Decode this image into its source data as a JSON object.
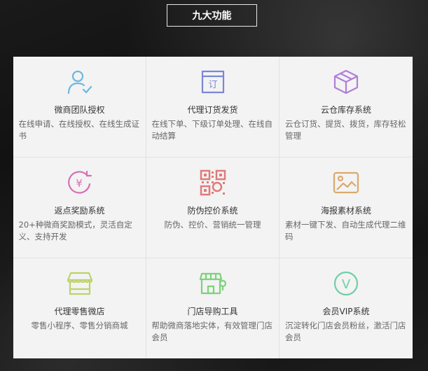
{
  "header": {
    "title": "九大功能"
  },
  "features": [
    {
      "icon": "user-check-icon",
      "color": "#6bb8e0",
      "name": "微商团队授权",
      "desc": "在线申请、在线授权、在线生成证书"
    },
    {
      "icon": "order-box-icon",
      "color": "#7c86d6",
      "name": "代理订货发货",
      "desc": "在线下单、下级订单处理、在线自动结算",
      "glyph": "订"
    },
    {
      "icon": "cube-icon",
      "color": "#b07fd8",
      "name": "云仓库存系统",
      "desc": "云仓订货、提货、拨货，库存轻松管理"
    },
    {
      "icon": "yen-rebate-icon",
      "color": "#d86fb3",
      "name": "返点奖励系统",
      "desc": "20+种微商奖励模式，灵活自定义、支持开发",
      "glyph": "¥"
    },
    {
      "icon": "qr-code-icon",
      "color": "#e07a7a",
      "name": "防伪控价系统",
      "desc": "防伪、控价、营销统一管理"
    },
    {
      "icon": "image-icon",
      "color": "#d9aa6a",
      "name": "海报素材系统",
      "desc": "素材一键下发、自动生成代理二维码"
    },
    {
      "icon": "store-icon",
      "color": "#bcd36a",
      "name": "代理零售微店",
      "desc": "零售小程序、零售分销商城"
    },
    {
      "icon": "shop-guide-icon",
      "color": "#7cd27a",
      "name": "门店导购工具",
      "desc": "帮助微商落地实体，有效管理门店会员"
    },
    {
      "icon": "vip-icon",
      "color": "#6fcfa6",
      "name": "会员VIP系统",
      "desc": "沉淀转化门店会员粉丝，激活门店会员",
      "glyph": "V"
    }
  ]
}
